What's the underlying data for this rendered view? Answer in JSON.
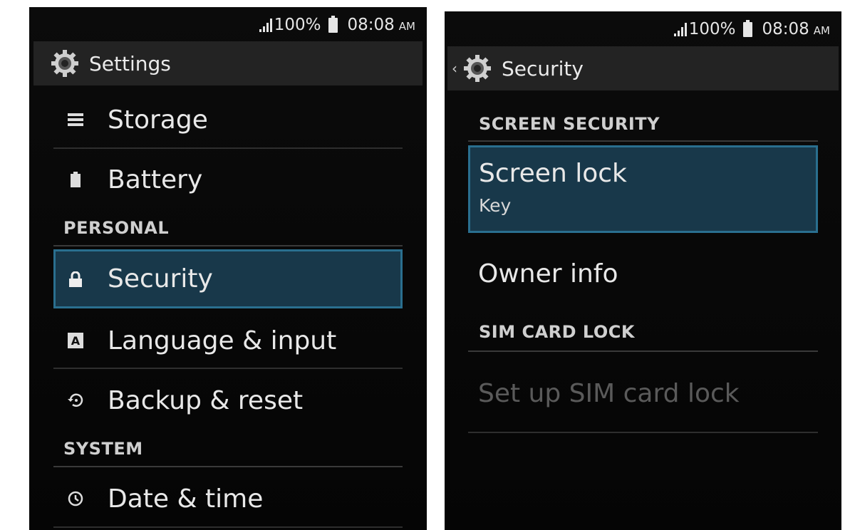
{
  "status": {
    "battery": "100%",
    "time": "08:08",
    "ampm": "AM"
  },
  "left": {
    "title": "Settings",
    "items_top": [
      {
        "label": "Storage",
        "icon": "storage-icon"
      },
      {
        "label": "Battery",
        "icon": "battery-icon"
      }
    ],
    "section_personal": "PERSONAL",
    "personal_items": [
      {
        "label": "Security",
        "icon": "lock-icon",
        "selected": true
      },
      {
        "label": "Language & input",
        "icon": "keyboard-icon"
      },
      {
        "label": "Backup & reset",
        "icon": "restore-icon"
      }
    ],
    "section_system": "SYSTEM",
    "system_items": [
      {
        "label": "Date & time",
        "icon": "clock-icon"
      }
    ]
  },
  "right": {
    "title": "Security",
    "section_screen": "SCREEN SECURITY",
    "screen_lock": {
      "label": "Screen lock",
      "value": "Key"
    },
    "owner_info": "Owner info",
    "section_sim": "SIM CARD LOCK",
    "sim_lock": "Set up SIM card lock"
  },
  "colors": {
    "selected_bg": "#18384a",
    "selected_border": "#2a6f8f",
    "actionbar": "#232323"
  }
}
